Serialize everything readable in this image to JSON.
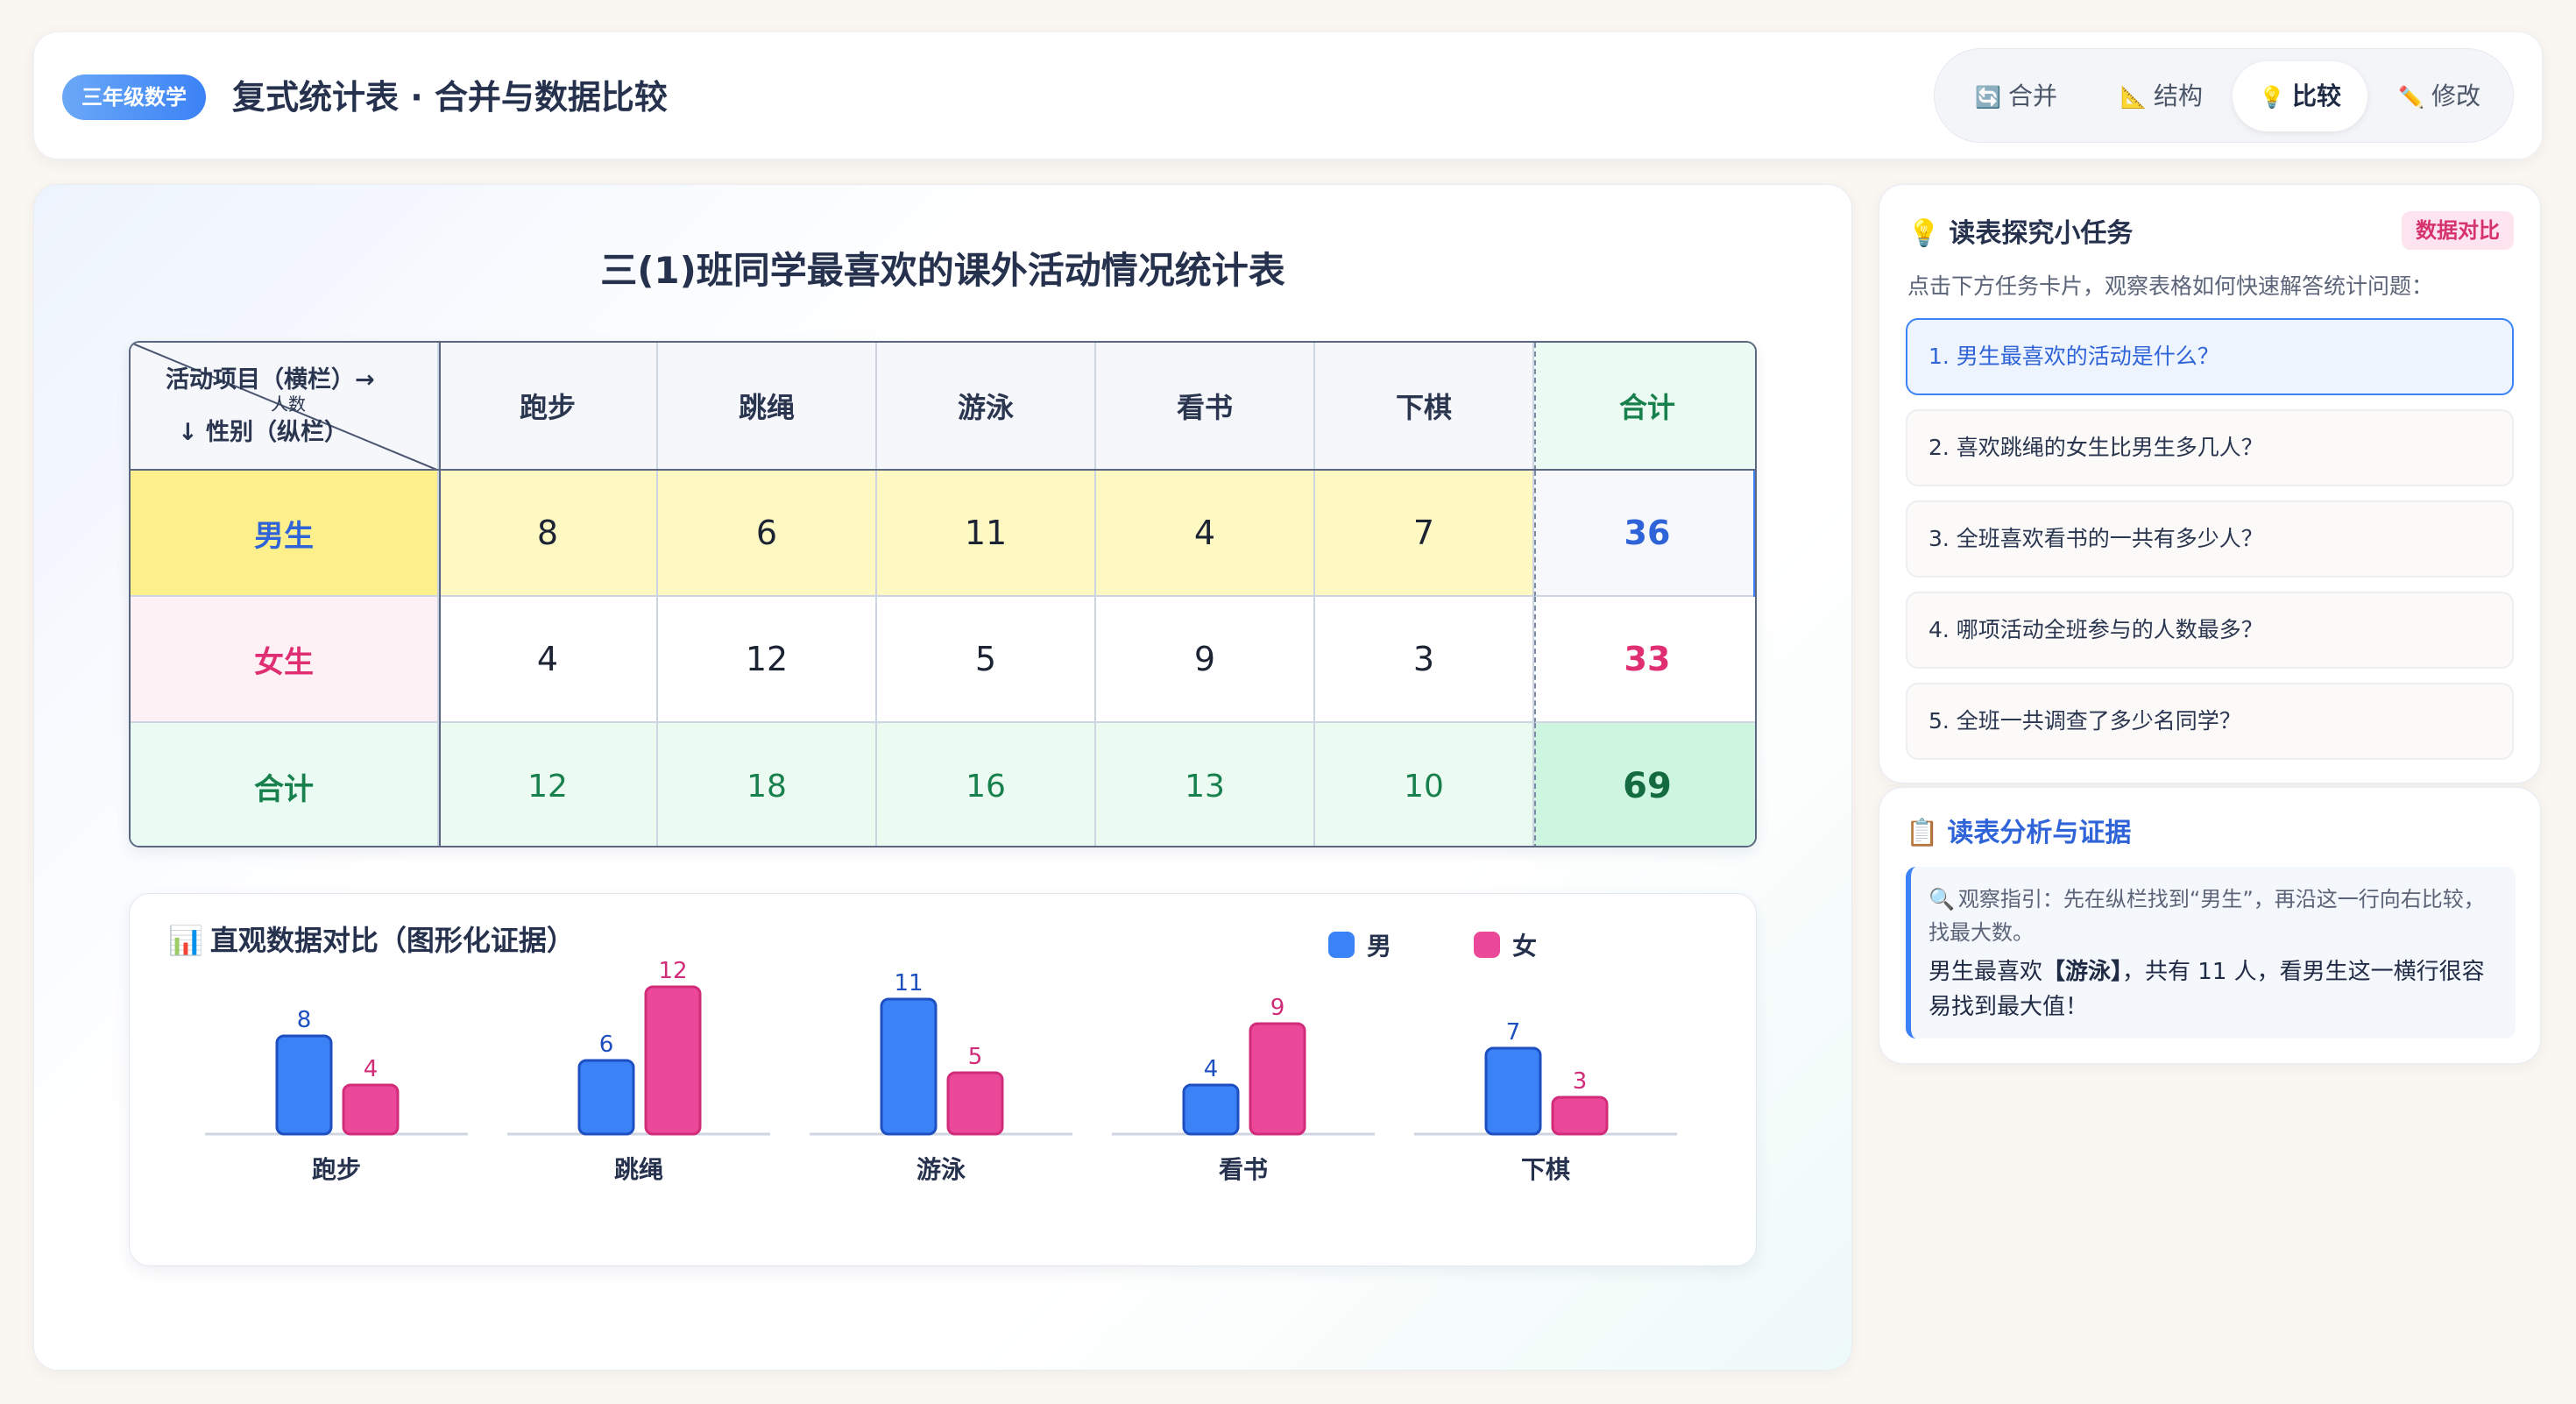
{
  "header": {
    "grade_badge": "三年级数学",
    "title": "复式统计表 · 合并与数据比较",
    "tabs": [
      {
        "icon": "🔄",
        "label": "合并",
        "active": false
      },
      {
        "icon": "📐",
        "label": "结构",
        "active": false
      },
      {
        "icon": "💡",
        "label": "比较",
        "active": true
      },
      {
        "icon": "✏️",
        "label": "修改",
        "active": false
      }
    ]
  },
  "table": {
    "title": "三(1)班同学最喜欢的课外活动情况统计表",
    "corner": {
      "top": "活动项目（横栏）→",
      "mid": "人数",
      "bottom": "↓ 性别（纵栏）"
    },
    "columns": [
      "跑步",
      "跳绳",
      "游泳",
      "看书",
      "下棋",
      "合计"
    ],
    "rows": [
      {
        "label": "男生",
        "values": [
          "8",
          "6",
          "11",
          "4",
          "7"
        ],
        "total": "36"
      },
      {
        "label": "女生",
        "values": [
          "4",
          "12",
          "5",
          "9",
          "3"
        ],
        "total": "33"
      },
      {
        "label": "合计",
        "values": [
          "12",
          "18",
          "16",
          "13",
          "10"
        ],
        "total": "69"
      }
    ]
  },
  "chart": {
    "title_icon": "📊",
    "title": "直观数据对比（图形化证据）",
    "legend": [
      {
        "name": "男",
        "color": "#3b82f6"
      },
      {
        "name": "女",
        "color": "#ec4899"
      }
    ]
  },
  "chart_data": {
    "type": "bar",
    "title": "直观数据对比（图形化证据）",
    "categories": [
      "跑步",
      "跳绳",
      "游泳",
      "看书",
      "下棋"
    ],
    "series": [
      {
        "name": "男",
        "values": [
          8,
          6,
          11,
          4,
          7
        ],
        "color": "#3b82f6"
      },
      {
        "name": "女",
        "values": [
          4,
          12,
          5,
          9,
          3
        ],
        "color": "#ec4899"
      }
    ],
    "xlabel": "",
    "ylabel": "",
    "ylim": [
      0,
      12
    ],
    "grid": false,
    "legend_position": "top-right"
  },
  "tasks": {
    "title_icon": "💡",
    "title": "读表探究小任务",
    "badge": "数据对比",
    "hint": "点击下方任务卡片，观察表格如何快速解答统计问题：",
    "items": [
      "1. 男生最喜欢的活动是什么？",
      "2. 喜欢跳绳的女生比男生多几人？",
      "3. 全班喜欢看书的一共有多少人？",
      "4. 哪项活动全班参与的人数最多？",
      "5. 全班一共调查了多少名同学？"
    ],
    "active_index": 0
  },
  "analysis": {
    "title_icon": "📋",
    "title": "读表分析与证据",
    "guide_icon": "🔍",
    "guide": "观察指引：先在纵栏找到“男生”，再沿这一行向右比较，找最大数。",
    "answer_prefix": "男生最喜欢",
    "answer_bold": "【游泳】",
    "answer_suffix": "，共有 11 人，看男生这一横行很容易找到最大值！"
  }
}
